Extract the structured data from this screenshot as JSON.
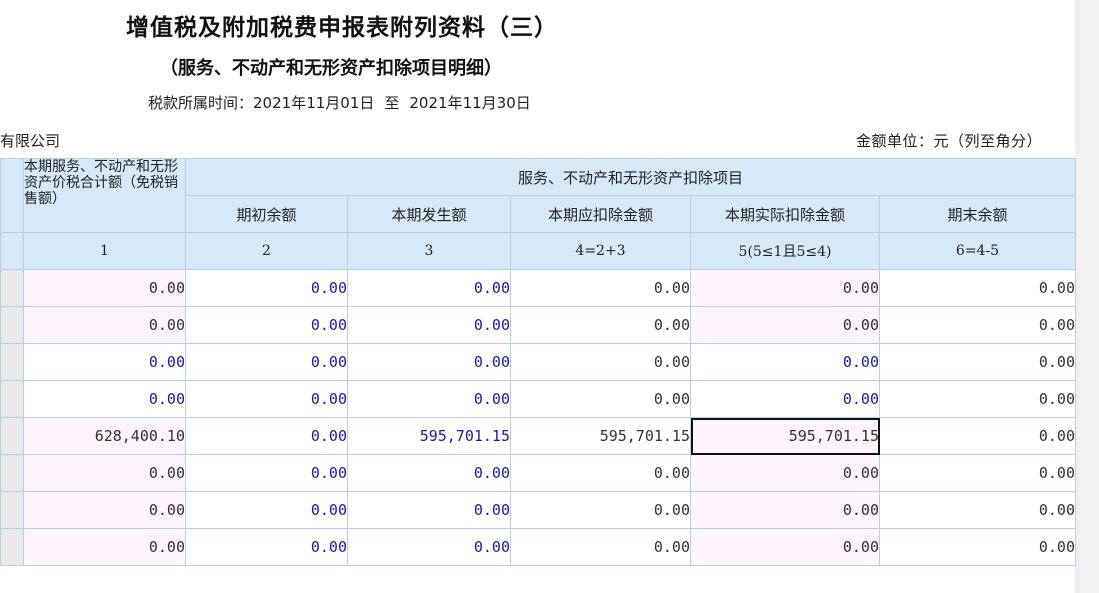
{
  "form": {
    "title": "增值税及附加税费申报表附列资料（三）",
    "subtitle": "（服务、不动产和无形资产扣除项目明细）",
    "period_label": "税款所属时间：",
    "period_start": "2021年11月01日",
    "period_to": "至",
    "period_end": "2021年11月30日",
    "company": "有限公司",
    "unit": "金额单位：元（列至角分）"
  },
  "table": {
    "col1_header": "本期服务、不动产和无形资产价税合计额（免税销售额）",
    "group_header": "服务、不动产和无形资产扣除项目",
    "headers": [
      "期初余额",
      "本期发生额",
      "本期应扣除金额",
      "本期实际扣除金额",
      "期末余额"
    ],
    "col_index": [
      "1",
      "2",
      "3",
      "4=2+3",
      "5(5≤1且5≤4)",
      "6=4-5"
    ],
    "rows": [
      {
        "c1": "0.00",
        "c2": "0.00",
        "c3": "0.00",
        "c4": "0.00",
        "c5": "0.00",
        "c6": "0.00"
      },
      {
        "c1": "0.00",
        "c2": "0.00",
        "c3": "0.00",
        "c4": "0.00",
        "c5": "0.00",
        "c6": "0.00"
      },
      {
        "c1": "0.00",
        "c2": "0.00",
        "c3": "0.00",
        "c4": "0.00",
        "c5": "0.00",
        "c6": "0.00"
      },
      {
        "c1": "0.00",
        "c2": "0.00",
        "c3": "0.00",
        "c4": "0.00",
        "c5": "0.00",
        "c6": "0.00"
      },
      {
        "c1": "628,400.10",
        "c2": "0.00",
        "c3": "595,701.15",
        "c4": "595,701.15",
        "c5": "595,701.15",
        "c6": "0.00"
      },
      {
        "c1": "0.00",
        "c2": "0.00",
        "c3": "0.00",
        "c4": "0.00",
        "c5": "0.00",
        "c6": "0.00"
      },
      {
        "c1": "0.00",
        "c2": "0.00",
        "c3": "0.00",
        "c4": "0.00",
        "c5": "0.00",
        "c6": "0.00"
      },
      {
        "c1": "0.00",
        "c2": "0.00",
        "c3": "0.00",
        "c4": "0.00",
        "c5": "0.00",
        "c6": "0.00"
      }
    ]
  },
  "colors": {
    "header_bg": "#d6e9f8",
    "editable_text": "#1a1aa8",
    "readonly_bg": "#fdf5fb",
    "border": "#b9cfe6"
  }
}
